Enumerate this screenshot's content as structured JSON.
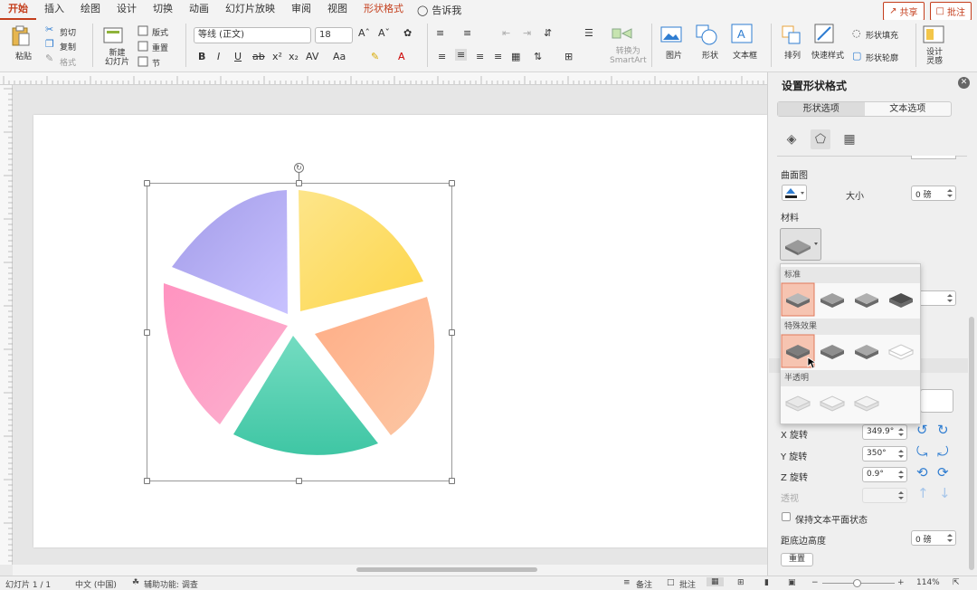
{
  "tabs": [
    "开始",
    "插入",
    "绘图",
    "设计",
    "切换",
    "动画",
    "幻灯片放映",
    "审阅",
    "视图",
    "形状格式"
  ],
  "tell_me": "告诉我",
  "share_label": "共享",
  "comment_label": "批注",
  "ribbon": {
    "paste": "粘贴",
    "cut": "剪切",
    "copy": "复制",
    "format": "格式",
    "new_slide": "新建\n幻灯片",
    "layout": "版式",
    "reset": "重置",
    "section": "节",
    "font_name": "等线 (正文)",
    "font_size": "18",
    "convert_smartart": "转换为\nSmartArt",
    "picture": "图片",
    "shape": "形状",
    "textbox": "文本框",
    "arrange": "排列",
    "quick_styles": "快速样式",
    "shape_fill": "形状填充",
    "shape_outline": "形状轮廓",
    "design_ideas": "设计\n灵感"
  },
  "pane": {
    "title": "设置形状格式",
    "tab_shape": "形状选项",
    "tab_text": "文本选项",
    "contour": "曲面图",
    "size_label": "大小",
    "size_value": "0 磅",
    "material": "材料",
    "x_rotation_label": "X 旋转",
    "x_rotation_value": "349.9°",
    "y_rotation_label": "Y 旋转",
    "y_rotation_value": "350°",
    "z_rotation_label": "Z 旋转",
    "z_rotation_value": "0.9°",
    "perspective_label": "透视",
    "keep_text_flat": "保持文本平面状态",
    "distance_label": "距底边高度",
    "distance_value": "0 磅",
    "reset_button": "重置"
  },
  "dropdown": {
    "standard": "标准",
    "special": "特殊效果",
    "translucent": "半透明"
  },
  "status": {
    "slide": "幻灯片 1 / 1",
    "language": "中文 (中国)",
    "accessibility": "辅助功能: 调查",
    "notes": "备注",
    "comments": "批注",
    "zoom": "114%"
  },
  "colors": {
    "accent": "#c43e1c",
    "pie_purple": "#b3acf2",
    "pie_yellow": "#fde27a",
    "pie_orange": "#ffb28c",
    "pie_green": "#5fd2b4",
    "pie_pink": "#fda1c7"
  }
}
